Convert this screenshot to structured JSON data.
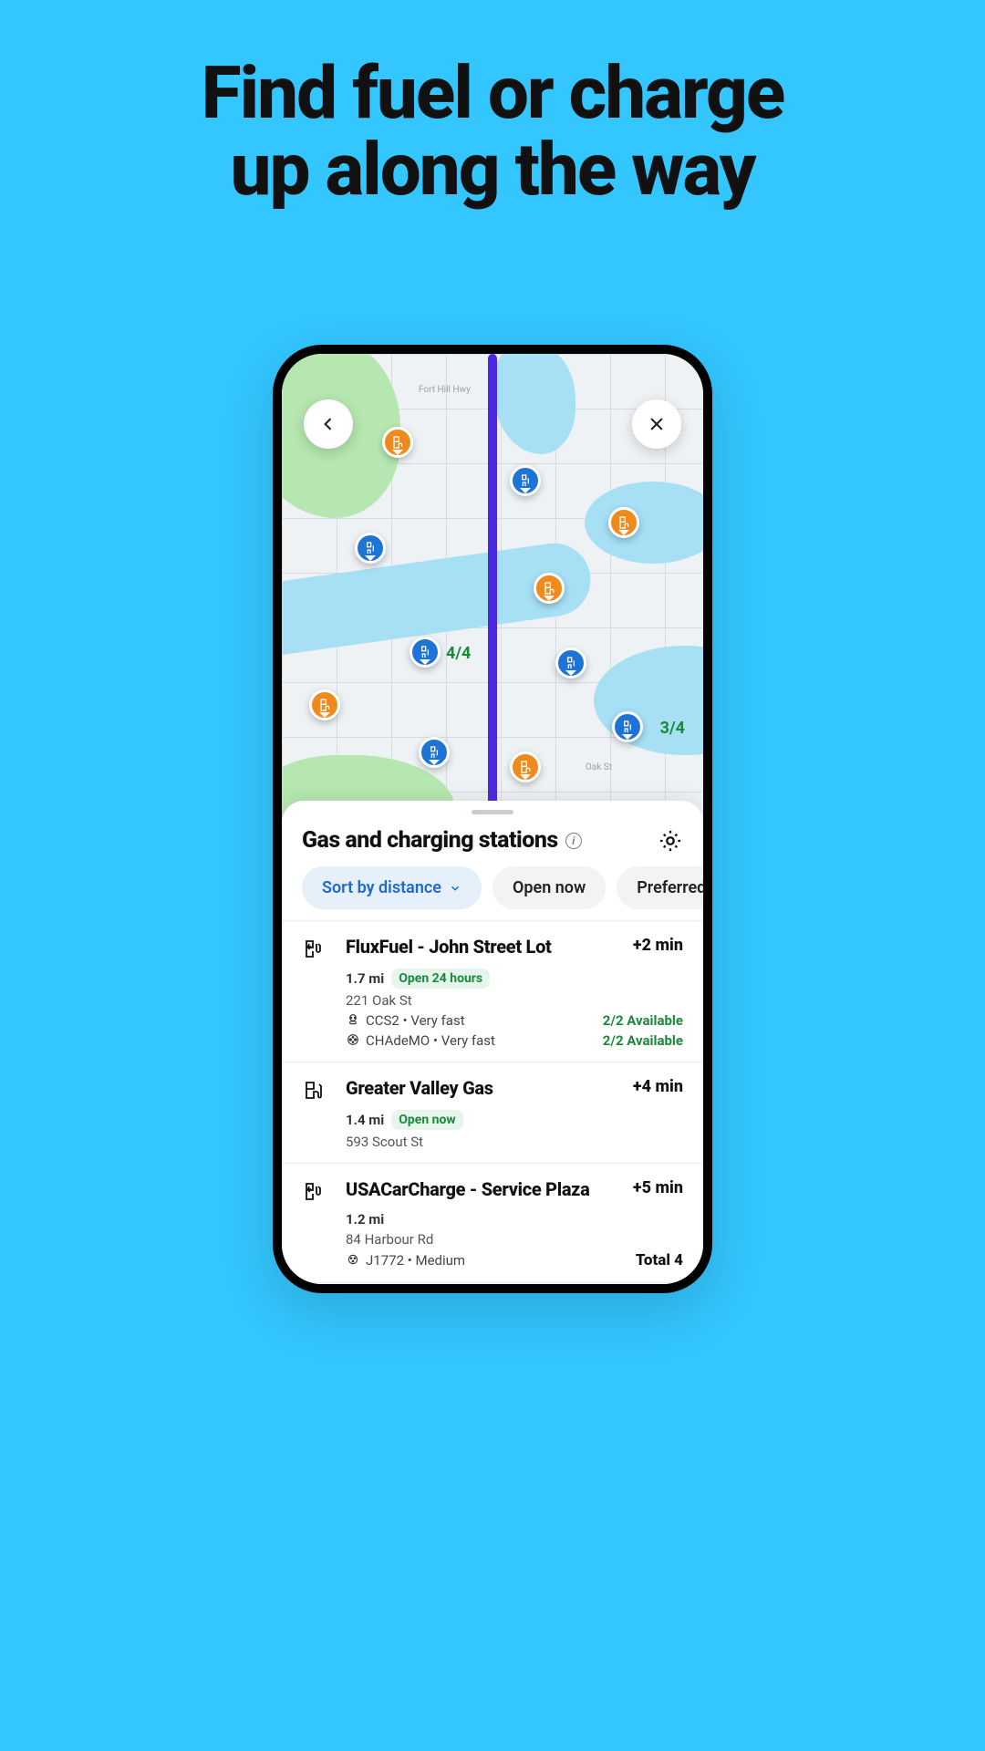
{
  "hero": {
    "line1": "Find fuel or charge",
    "line2": "up along the way"
  },
  "map": {
    "labels": {
      "top_road": "Fort Hill Hwy",
      "bottom_road": "Oak St"
    },
    "pins": {
      "p44": "4/4",
      "p34": "3/4"
    }
  },
  "sheet": {
    "title": "Gas and charging stations",
    "filters": {
      "sort": "Sort by distance",
      "open_now": "Open now",
      "preferred": "Preferred brands"
    },
    "items": [
      {
        "kind": "ev",
        "name": "FluxFuel - John Street Lot",
        "detour": "+2 min",
        "distance": "1.7 mi",
        "open": "Open 24 hours",
        "address": "221 Oak St",
        "connectors": [
          {
            "label": "CCS2 • Very fast",
            "avail": "2/2 Available"
          },
          {
            "label": "CHAdeMO • Very fast",
            "avail": "2/2 Available"
          }
        ]
      },
      {
        "kind": "gas",
        "name": "Greater Valley Gas",
        "detour": "+4 min",
        "distance": "1.4 mi",
        "open": "Open now",
        "address": "593 Scout St"
      },
      {
        "kind": "ev",
        "name": "USACarCharge - Service Plaza",
        "detour": "+5 min",
        "distance": "1.2 mi",
        "address": "84 Harbour Rd",
        "connectors": [
          {
            "label": "J1772 • Medium",
            "total": "Total 4"
          }
        ]
      }
    ]
  }
}
